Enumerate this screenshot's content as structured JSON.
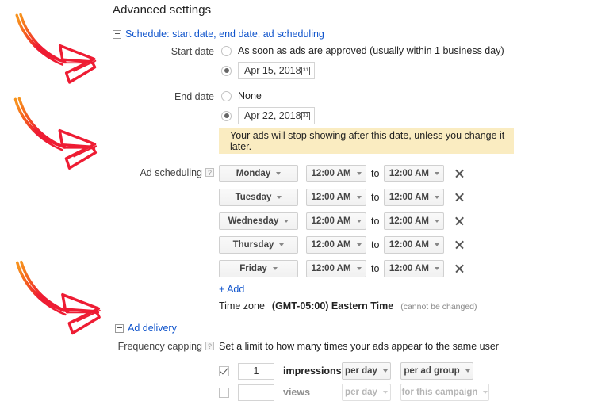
{
  "page": {
    "title": "Advanced settings"
  },
  "schedule_section": {
    "link_label": "Schedule: start date, end date, ad scheduling",
    "toggle_icon": "collapse-box-icon",
    "start_date": {
      "label": "Start date",
      "option_asap": {
        "text": "As soon as ads are approved (usually within 1 business day)",
        "selected": false
      },
      "option_date": {
        "value": "Apr 15, 2018",
        "selected": true,
        "icon": "calendar-icon",
        "icon_glyph": "31"
      }
    },
    "end_date": {
      "label": "End date",
      "option_none": {
        "text": "None",
        "selected": false
      },
      "option_date": {
        "value": "Apr 22, 2018",
        "selected": true,
        "icon": "calendar-icon",
        "icon_glyph": "31"
      }
    },
    "warning": {
      "text": "Your ads will stop showing after this date, unless you change it later.",
      "background": "#faecc1"
    },
    "ad_scheduling": {
      "label": "Ad scheduling",
      "help_glyph": "?",
      "to_label": "to",
      "remove_icon": "close-x-icon",
      "rows": [
        {
          "day": "Monday",
          "start_time": "12:00 AM",
          "end_time": "12:00 AM"
        },
        {
          "day": "Tuesday",
          "start_time": "12:00 AM",
          "end_time": "12:00 AM"
        },
        {
          "day": "Wednesday",
          "start_time": "12:00 AM",
          "end_time": "12:00 AM"
        },
        {
          "day": "Thursday",
          "start_time": "12:00 AM",
          "end_time": "12:00 AM"
        },
        {
          "day": "Friday",
          "start_time": "12:00 AM",
          "end_time": "12:00 AM"
        }
      ],
      "add_link": "+ Add"
    },
    "time_zone": {
      "label": "Time zone",
      "value": "(GMT-05:00) Eastern Time",
      "note": "(cannot be changed)"
    }
  },
  "ad_delivery_section": {
    "link_label": "Ad delivery",
    "toggle_icon": "collapse-box-icon",
    "frequency_capping": {
      "label": "Frequency capping",
      "help_glyph": "?",
      "description": "Set a limit to how many times your ads appear to the same user",
      "rows": [
        {
          "checked": true,
          "amount": "1",
          "unit": "impressions",
          "per": "per day",
          "scope": "per ad group",
          "disabled": false
        },
        {
          "checked": false,
          "amount": "",
          "unit": "views",
          "per": "per day",
          "scope": "for this campaign",
          "disabled": true
        }
      ]
    }
  },
  "annotations": {
    "arrow_color_start": "#f7941e",
    "arrow_color_end": "#ee1c33",
    "arrows": [
      {
        "name": "arrow-to-schedule-section"
      },
      {
        "name": "arrow-to-ad-scheduling"
      },
      {
        "name": "arrow-to-ad-delivery"
      }
    ]
  }
}
